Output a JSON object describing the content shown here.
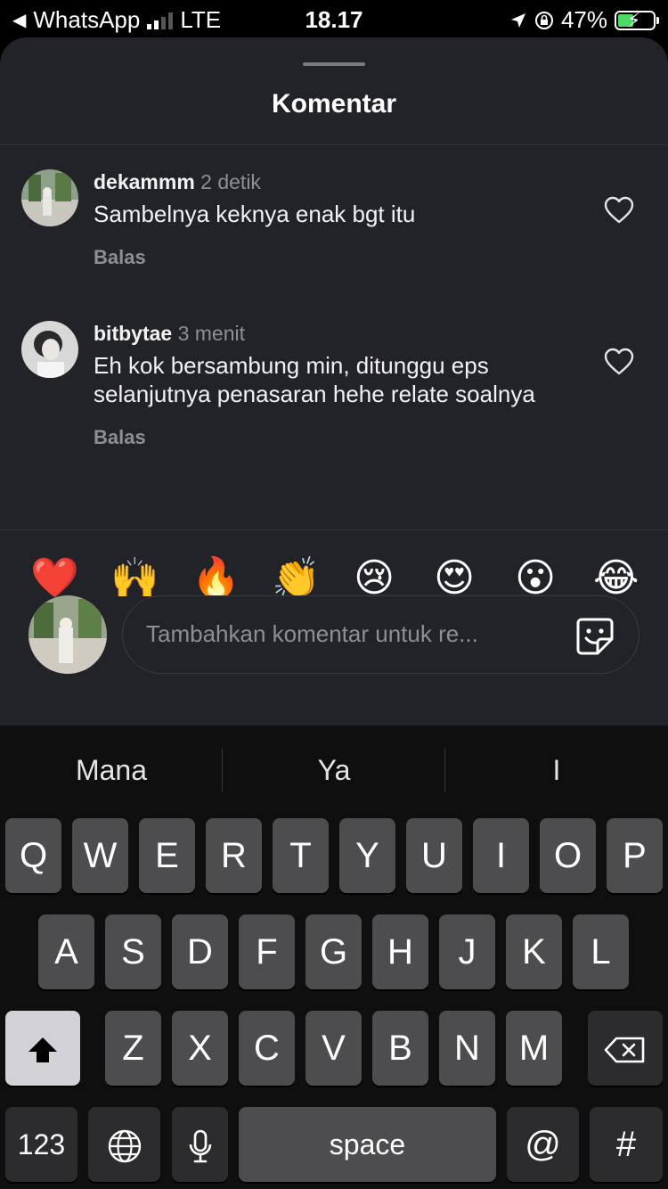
{
  "status_bar": {
    "back_app": "WhatsApp",
    "network": "LTE",
    "time": "18.17",
    "battery": "47%"
  },
  "sheet": {
    "title": "Komentar"
  },
  "comments": [
    {
      "user": "dekammm",
      "time": "2 detik",
      "text": "Sambelnya keknya enak bgt itu",
      "reply": "Balas"
    },
    {
      "user": "bitbytae",
      "time": "3 menit",
      "text": "Eh kok bersambung min, ditunggu eps selanjutnya penasaran hehe relate soalnya",
      "reply": "Balas"
    }
  ],
  "emojis": [
    "❤️",
    "🙌",
    "🔥",
    "👏",
    "😢",
    "😍",
    "😮",
    "😂"
  ],
  "compose": {
    "placeholder": "Tambahkan komentar untuk re..."
  },
  "keyboard": {
    "suggestions": [
      "Mana",
      "Ya",
      "I"
    ],
    "row1": [
      "Q",
      "W",
      "E",
      "R",
      "T",
      "Y",
      "U",
      "I",
      "O",
      "P"
    ],
    "row2": [
      "A",
      "S",
      "D",
      "F",
      "G",
      "H",
      "J",
      "K",
      "L"
    ],
    "row3": [
      "Z",
      "X",
      "C",
      "V",
      "B",
      "N",
      "M"
    ],
    "numbers_label": "123",
    "space_label": "space",
    "at_label": "@",
    "hash_label": "#"
  }
}
